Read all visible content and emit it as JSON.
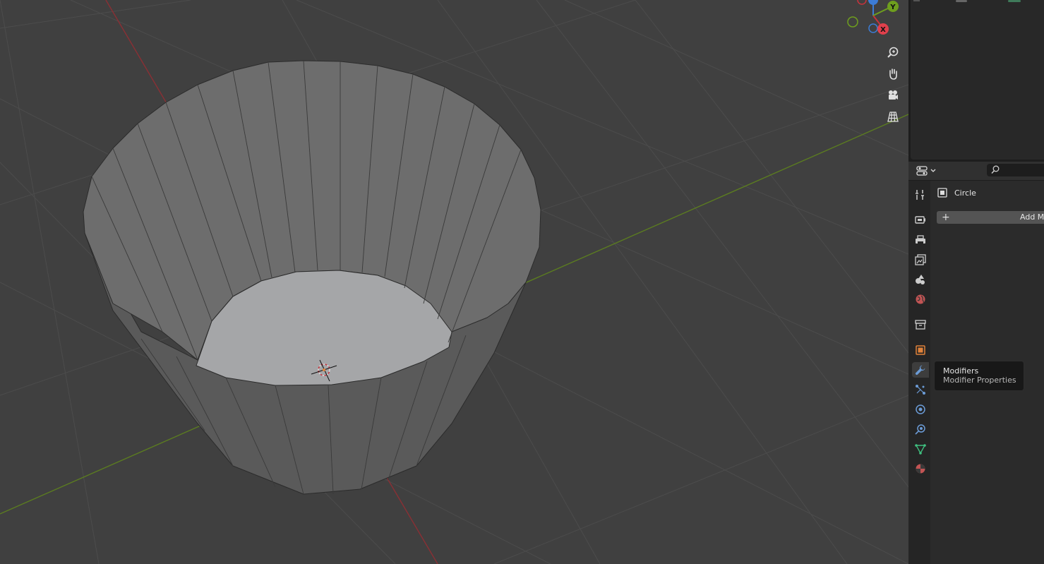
{
  "viewport": {
    "gizmo_axes": [
      "X",
      "Y"
    ],
    "nav_buttons": [
      {
        "icon": "zoom-icon"
      },
      {
        "icon": "hand-pan-icon"
      },
      {
        "icon": "camera-icon"
      },
      {
        "icon": "perspective-grid-icon"
      }
    ]
  },
  "properties": {
    "search_placeholder": "",
    "tabs": [
      {
        "id": "tool",
        "icon": "tool-icon"
      },
      {
        "id": "render",
        "icon": "render-icon"
      },
      {
        "id": "output",
        "icon": "output-icon"
      },
      {
        "id": "view-layer",
        "icon": "view-layer-icon"
      },
      {
        "id": "scene",
        "icon": "scene-icon"
      },
      {
        "id": "world",
        "icon": "world-icon"
      },
      {
        "id": "collection",
        "icon": "collection-icon"
      },
      {
        "id": "object",
        "icon": "object-icon"
      },
      {
        "id": "modifiers",
        "icon": "wrench-icon",
        "active": true
      },
      {
        "id": "particles",
        "icon": "particles-icon"
      },
      {
        "id": "physics",
        "icon": "physics-icon"
      },
      {
        "id": "constraints",
        "icon": "constraints-icon"
      },
      {
        "id": "data",
        "icon": "mesh-data-icon"
      },
      {
        "id": "material",
        "icon": "material-icon"
      }
    ],
    "object_name": "Circle",
    "add_modifier_label": "Add M"
  },
  "tooltip": {
    "title": "Modifiers",
    "description": "Modifier Properties"
  },
  "colors": {
    "x_axis": "#c8323c",
    "y_axis": "#6e9e1e",
    "z_axis": "#3c7cd6",
    "object_orange": "#e0823a",
    "modifier_blue": "#6b9bd6"
  }
}
